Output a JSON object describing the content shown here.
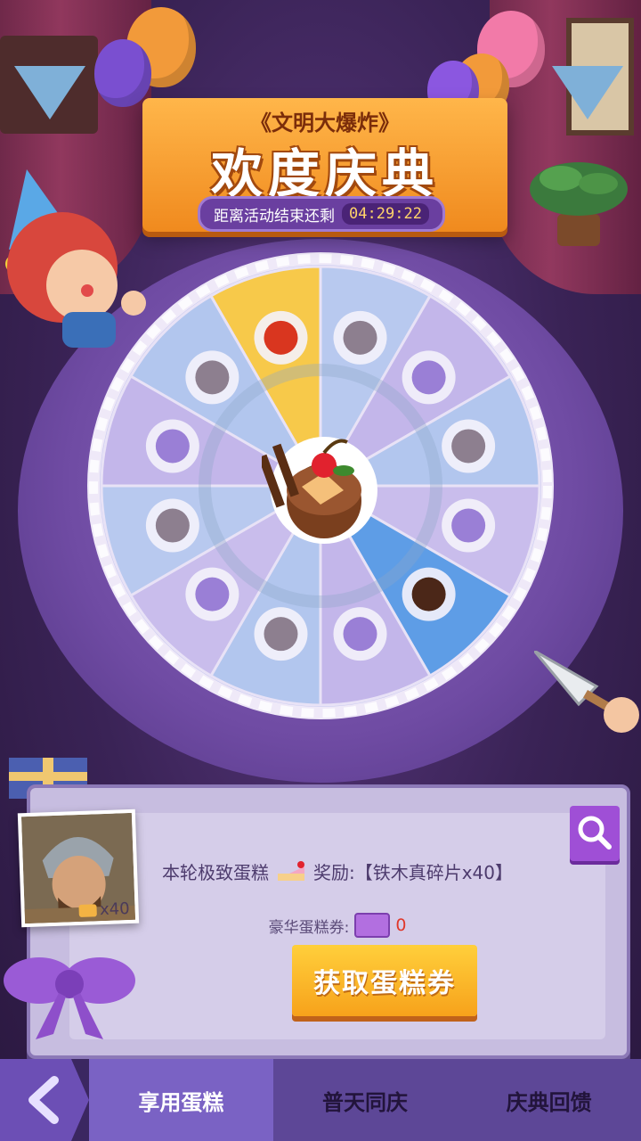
{
  "header": {
    "subtitle": "《文明大爆炸》",
    "title": "欢度庆典",
    "countdown_label": "距离活动结束还剩",
    "countdown_value": "04:29:22"
  },
  "reward_panel": {
    "reward_prefix": "本轮极致蛋糕",
    "reward_text": "奖励:【铁木真碎片x40】",
    "voucher_label": "豪华蛋糕券:",
    "voucher_count": "0",
    "get_button": "获取蛋糕券",
    "hero_count": "x40"
  },
  "tabs": [
    {
      "label": "享用蛋糕",
      "active": true
    },
    {
      "label": "普天同庆",
      "active": false
    },
    {
      "label": "庆典回馈",
      "active": false
    }
  ],
  "wheel": {
    "slices": 12,
    "highlight_colors": {
      "gold": "#f7c94a",
      "blue": "#5e9de6"
    }
  }
}
